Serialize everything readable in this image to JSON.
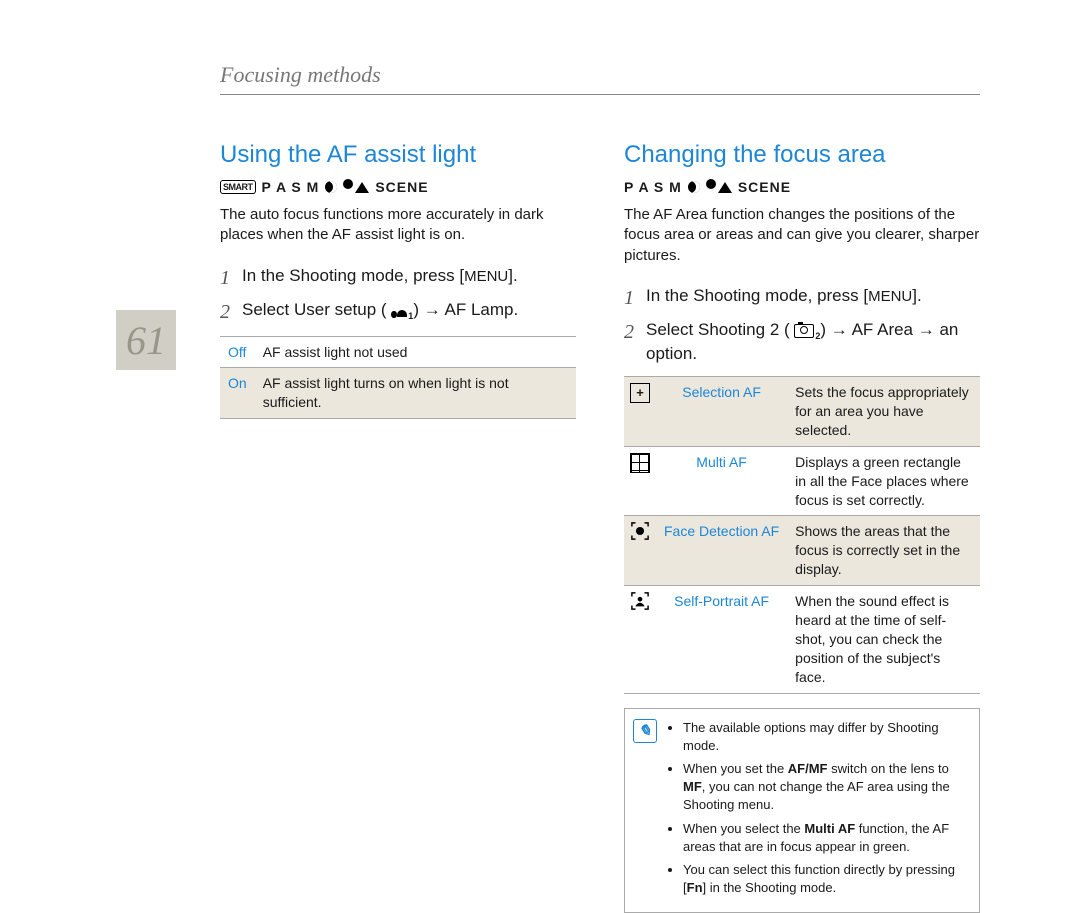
{
  "page_number": "61",
  "header": "Focusing methods",
  "left": {
    "title": "Using the AF assist light",
    "modes_smart": "SMART",
    "modes_text": "P A S M",
    "modes_scene": "SCENE",
    "intro": "The auto focus functions more accurately in dark places when the AF assist light is on.",
    "steps": [
      {
        "n": "1",
        "pre": "In the Shooting mode, press [",
        "key": "MENU",
        "post": "]."
      },
      {
        "n": "2",
        "pre": "Select ",
        "bold": "User setup",
        "icon": "user",
        "sub": "1",
        "post_arrow": " → ",
        "tail": "AF Lamp",
        "end": "."
      }
    ],
    "table": [
      {
        "key": "Off",
        "desc": "AF assist light not used"
      },
      {
        "key": "On",
        "desc": "AF assist light turns on when light is not sufficient."
      }
    ]
  },
  "right": {
    "title": "Changing the focus area",
    "modes_text": "P A S M",
    "modes_scene": "SCENE",
    "intro": "The AF Area function changes the positions of the focus area or areas and can give you clearer, sharper pictures.",
    "steps": [
      {
        "n": "1",
        "pre": "In the Shooting mode, press [",
        "key": "MENU",
        "post": "]."
      },
      {
        "n": "2",
        "pre": "Select ",
        "bold": "Shooting 2",
        "icon": "camera",
        "sub": "2",
        "post_arrow": " → ",
        "mid": "AF Area",
        "post_arrow2": " → ",
        "tail": "an option."
      }
    ],
    "table": [
      {
        "icon": "selection",
        "key": "Selection AF",
        "desc": "Sets the focus appropriately for an area you have selected."
      },
      {
        "icon": "grid",
        "key": "Multi AF",
        "desc": "Displays a green rectangle in all the Face places where focus is set correctly."
      },
      {
        "icon": "face",
        "key": "Face Detection AF",
        "desc": "Shows the areas that the focus is correctly set in the display."
      },
      {
        "icon": "self",
        "key": "Self-Portrait AF",
        "desc": "When the sound effect is heard at the time of self-shot, you can check the position of the subject's face."
      }
    ],
    "notes": [
      "The available options may differ by Shooting mode.",
      "When you set the <b>AF/MF</b> switch on the lens to <b>MF</b>, you can not change the AF area using the Shooting menu.",
      "When you select the <b>Multi AF</b> function, the AF areas that are in focus appear in green.",
      "You can select this function directly by pressing [<b>Fn</b>] in the Shooting mode."
    ]
  }
}
